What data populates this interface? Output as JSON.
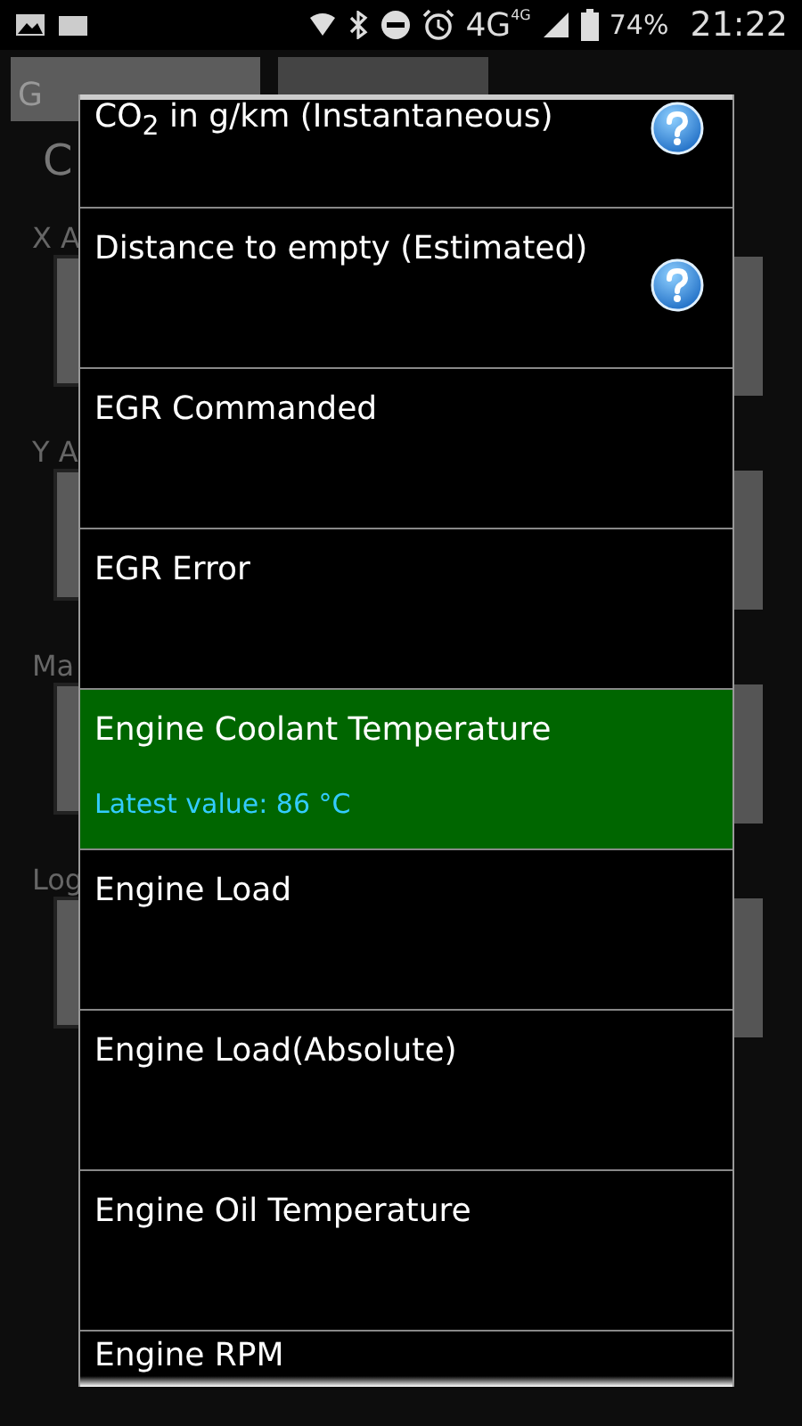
{
  "status_bar": {
    "battery": "74%",
    "time": "21:22",
    "network": "4G",
    "network_small": "4G"
  },
  "background": {
    "tabs": [
      {
        "label": "G",
        "selected": true
      },
      {
        "selected": false
      }
    ],
    "heading": "C",
    "labels": [
      "X A",
      "Y A",
      "Ma",
      "Log"
    ]
  },
  "dialog": {
    "items": [
      {
        "label": "CO$_{2}$ in g/km (Instantaneous)",
        "help": true,
        "selected": false
      },
      {
        "label": "Distance to empty (Estimated)",
        "help": true,
        "selected": false
      },
      {
        "label": "EGR Commanded",
        "help": false,
        "selected": false
      },
      {
        "label": "EGR Error",
        "help": false,
        "selected": false
      },
      {
        "label": "Engine Coolant Temperature",
        "help": false,
        "selected": true,
        "latest_value": "Latest value: 86 °C"
      },
      {
        "label": "Engine Load",
        "help": false,
        "selected": false
      },
      {
        "label": "Engine Load(Absolute)",
        "help": false,
        "selected": false
      },
      {
        "label": "Engine Oil Temperature",
        "help": false,
        "selected": false
      },
      {
        "label": "Engine RPM",
        "help": false,
        "selected": false
      }
    ]
  }
}
